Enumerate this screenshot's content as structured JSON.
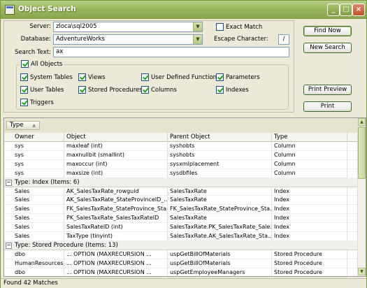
{
  "window": {
    "title": "Object Search"
  },
  "search": {
    "server_label": "Server:",
    "server_value": "zloca\\sql2005",
    "database_label": "Database:",
    "database_value": "AdventureWorks",
    "search_text_label": "Search Text:",
    "search_text_value": "ax",
    "exact_match_label": "Exact Match",
    "escape_char_label": "Escape Character:",
    "escape_char_value": "/"
  },
  "filters": {
    "all_objects": "All Objects",
    "items": [
      {
        "label": "System Tables",
        "checked": true
      },
      {
        "label": "Views",
        "checked": true
      },
      {
        "label": "User Defined Functions",
        "checked": true
      },
      {
        "label": "Parameters",
        "checked": true
      },
      {
        "label": "User Tables",
        "checked": true
      },
      {
        "label": "Stored Procedures",
        "checked": true
      },
      {
        "label": "Columns",
        "checked": true
      },
      {
        "label": "Indexes",
        "checked": true
      },
      {
        "label": "Triggers",
        "checked": true
      }
    ]
  },
  "buttons": {
    "find_now": "Find Now",
    "new_search": "New Search",
    "print_preview": "Print Preview",
    "print": "Print"
  },
  "grid": {
    "group_by": "Type",
    "columns": [
      "Owner",
      "Object",
      "Parent Object",
      "Type"
    ],
    "rows_top": [
      [
        "sys",
        "maxleaf (int)",
        "syshobts",
        "Column"
      ],
      [
        "sys",
        "maxnullbit (smallint)",
        "syshobts",
        "Column"
      ],
      [
        "sys",
        "maxoccur (int)",
        "sysxmlplacement",
        "Column"
      ],
      [
        "sys",
        "maxsize (int)",
        "sysdbfiles",
        "Column"
      ]
    ],
    "group_index": "Type: Index (Items: 6)",
    "rows_index": [
      [
        "Sales",
        "AK_SalesTaxRate_rowguid",
        "SalesTaxRate",
        "Index"
      ],
      [
        "Sales",
        "AK_SalesTaxRate_StateProvinceID_...",
        "SalesTaxRate",
        "Index"
      ],
      [
        "Sales",
        "FK_SalesTaxRate_StateProvince_Sta...",
        "FK_SalesTaxRate_StateProvince_Sta...",
        "Index"
      ],
      [
        "Sales",
        "PK_SalesTaxRate_SalesTaxRateID",
        "SalesTaxRate",
        "Index"
      ],
      [
        "Sales",
        "SalesTaxRateID (int)",
        "SalesTaxRate.PK_SalesTaxRate_Sale...",
        "Index"
      ],
      [
        "Sales",
        "TaxType (tinyint)",
        "SalesTaxRate.AK_SalesTaxRate_Sta...",
        "Index"
      ]
    ],
    "group_sp": "Type: Stored Procedure (Items: 13)",
    "rows_sp": [
      [
        "dbo",
        "... OPTION (MAXRECURSION ...",
        "uspGetBillOfMaterials",
        "Stored Procedure"
      ],
      [
        "HumanResources",
        "... OPTION (MAXRECURSION ...",
        "uspGetBillOfMaterials",
        "Stored Procedure"
      ],
      [
        "dbo",
        "... OPTION (MAXRECURSION ...",
        "uspGetEmployeeManagers",
        "Stored Procedure"
      ]
    ]
  },
  "status": {
    "text": "Found 42 Matches"
  },
  "icons": {
    "expander": "minus-icon",
    "dropdown": "chevron-down-icon",
    "scroll_up": "arrow-up-icon",
    "scroll_down": "arrow-down-icon"
  }
}
